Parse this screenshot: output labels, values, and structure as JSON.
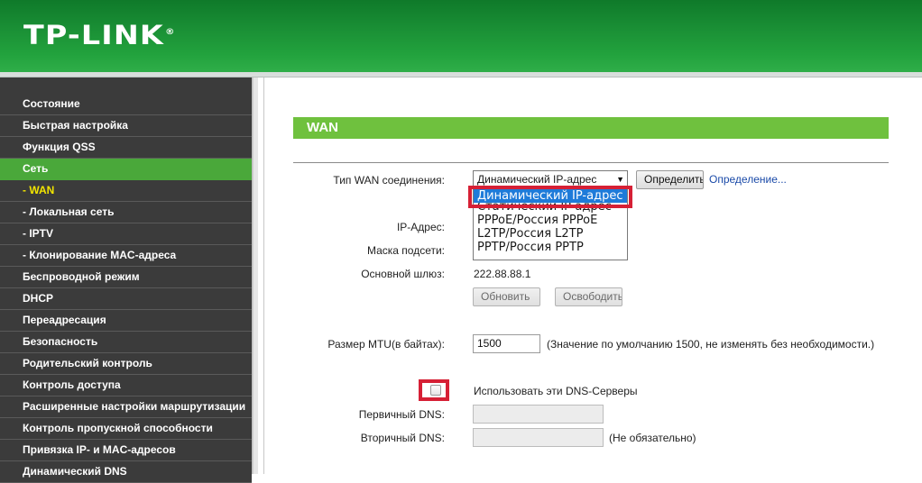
{
  "brand": {
    "logo": "TP-LINK",
    "reg_mark": "®"
  },
  "sidebar": {
    "items": [
      {
        "label": "Состояние"
      },
      {
        "label": "Быстрая настройка"
      },
      {
        "label": "Функция QSS"
      },
      {
        "label": "Сеть"
      },
      {
        "label": "- WAN"
      },
      {
        "label": "- Локальная сеть"
      },
      {
        "label": "- IPTV"
      },
      {
        "label": "- Клонирование MAC-адреса"
      },
      {
        "label": "Беспроводной режим"
      },
      {
        "label": "DHCP"
      },
      {
        "label": "Переадресация"
      },
      {
        "label": "Безопасность"
      },
      {
        "label": "Родительский контроль"
      },
      {
        "label": "Контроль доступа"
      },
      {
        "label": "Расширенные настройки маршрутизации"
      },
      {
        "label": "Контроль пропускной способности"
      },
      {
        "label": "Привязка IP- и MAC-адресов"
      },
      {
        "label": "Динамический DNS"
      }
    ]
  },
  "main": {
    "title": "WAN",
    "wan_type": {
      "label": "Тип WAN соединения:",
      "selected": "Динамический IP-адрес",
      "detect_button": "Определить",
      "detect_link": "Определение...",
      "options": [
        "Динамический IP-адрес",
        "Статический IP-адрес",
        "PPPoE/Россия PPPoE",
        "L2TP/Россия L2TP",
        "PPTP/Россия PPTP"
      ]
    },
    "ip_label": "IP-Адрес:",
    "mask_label": "Маска подсети:",
    "gateway": {
      "label": "Основной шлюз:",
      "value": "222.88.88.1"
    },
    "renew_button": "Обновить",
    "release_button": "Освободить",
    "mtu": {
      "label": "Размер MTU(в байтах):",
      "value": "1500",
      "hint": "(Значение по умолчанию 1500, не изменять без необходимости.)"
    },
    "dns_checkbox_label": "Использовать эти DNS-Серверы",
    "primary_dns": {
      "label": "Первичный DNS:",
      "value": ""
    },
    "secondary_dns": {
      "label": "Вторичный DNS:",
      "value": "",
      "hint": "(Не обязательно)"
    }
  },
  "colors": {
    "header_green": "#1a8f35",
    "active_green": "#4aa83a",
    "title_green": "#6fc13e",
    "sidebar_bg": "#3b3b3b",
    "highlight_red": "#d62035",
    "selection_blue": "#1e7bd9"
  }
}
